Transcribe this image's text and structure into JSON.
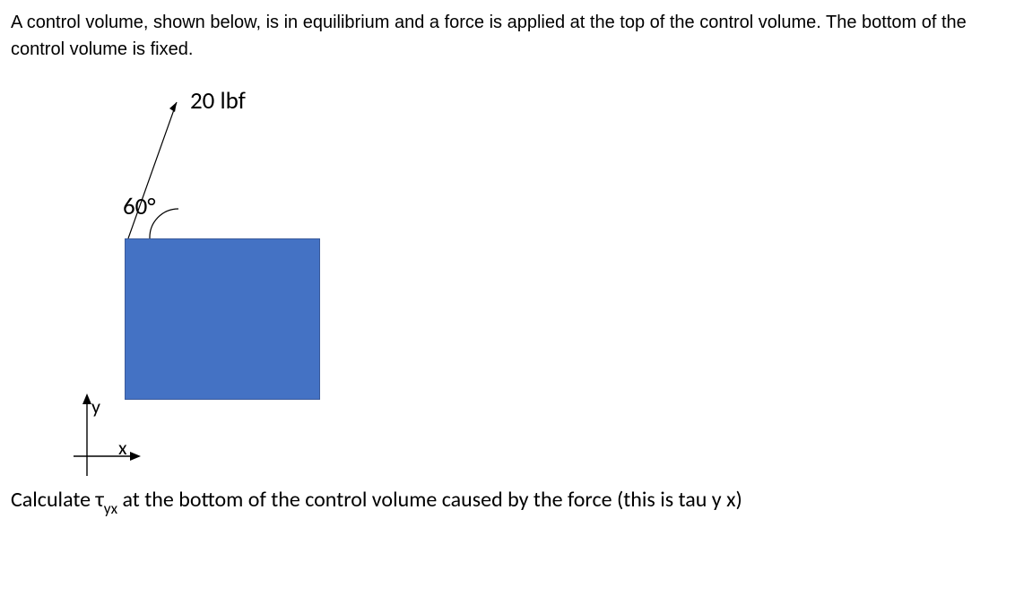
{
  "problem": {
    "intro": "A control volume, shown below, is in equilibrium and a force is applied at the top of the control volume. The bottom of the control volume is fixed."
  },
  "figure": {
    "force_label": "20 lbf",
    "angle_label": "60°",
    "axis_y": "y",
    "axis_x": "x"
  },
  "question": {
    "part1": "Calculate ",
    "tau": "τ",
    "sub": "yx",
    "part2": " at the bottom of the control volume caused by the force (this is tau y x)"
  }
}
